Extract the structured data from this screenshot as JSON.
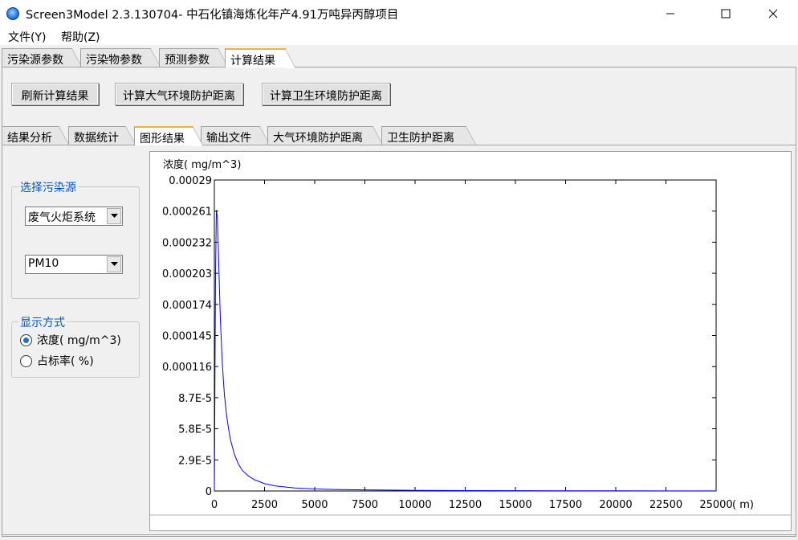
{
  "window": {
    "title": "Screen3Model 2.3.130704- 中石化镇海炼化年产4.91万吨异丙醇项目",
    "controls": [
      "minimize",
      "maximize",
      "close"
    ]
  },
  "menu": {
    "file": "文件(Y)",
    "help": "帮助(Z)"
  },
  "main_tabs": [
    "污染源参数",
    "污染物参数",
    "预测参数",
    "计算结果"
  ],
  "main_tab_active": "计算结果",
  "toolbar": {
    "refresh": "刷新计算结果",
    "calc_atmo": "计算大气环境防护距离",
    "calc_health": "计算卫生环境防护距离"
  },
  "sub_tabs": [
    "结果分析",
    "数据统计",
    "图形结果",
    "输出文件",
    "大气环境防护距离",
    "卫生防护距离"
  ],
  "sub_tab_active": "图形结果",
  "source_group": {
    "title": "选择污染源",
    "source_value": "废气火炬系统",
    "pollutant_value": "PM10"
  },
  "display_group": {
    "title": "显示方式",
    "options": [
      "浓度( mg/m^3)",
      "占标率( %)"
    ],
    "selected": "浓度( mg/m^3)"
  },
  "chart_data": {
    "type": "line",
    "ylabel": "浓度( mg/m^3)",
    "xlabel": "( m)",
    "x_ticks": [
      "0",
      "2500",
      "5000",
      "7500",
      "10000",
      "12500",
      "15000",
      "17500",
      "20000",
      "22500",
      "25000"
    ],
    "y_ticks": [
      "0",
      "2.9E-5",
      "5.8E-5",
      "8.7E-5",
      "0.000116",
      "0.000145",
      "0.000174",
      "0.000203",
      "0.000232",
      "0.000261",
      "0.00029"
    ],
    "xlim": [
      0,
      25000
    ],
    "ylim": [
      0,
      0.00029
    ],
    "line_color": "#0000ff",
    "series": [
      {
        "x": [
          0,
          10,
          30,
          60,
          100,
          150,
          200,
          250,
          300,
          400,
          500,
          600,
          700,
          800,
          1000,
          1200,
          1400,
          1700,
          2000,
          2500,
          3000,
          4000,
          5000,
          6000,
          7000,
          8000,
          10000,
          12500,
          15000,
          17500,
          20000,
          22500,
          25000
        ],
        "y": [
          0,
          3.3e-05,
          0.000115,
          0.000205,
          0.000262,
          0.000255,
          0.000225,
          0.00019,
          0.00016,
          0.000118,
          9e-05,
          7.2e-05,
          5.9e-05,
          4.8e-05,
          3.4e-05,
          2.5e-05,
          1.9e-05,
          1.4e-05,
          1.05e-05,
          6.8e-06,
          4.8e-06,
          2.8e-06,
          1.9e-06,
          1.4e-06,
          1.1e-06,
          9e-07,
          6e-07,
          4e-07,
          3e-07,
          2e-07,
          1.5e-07,
          1e-07,
          8e-08
        ]
      }
    ]
  }
}
